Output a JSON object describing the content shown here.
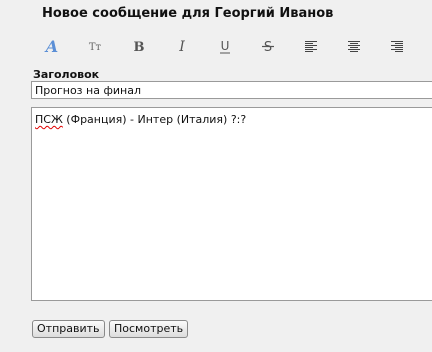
{
  "form": {
    "title": "Новое сообщение для Георгий Иванов",
    "subject_label": "Заголовок",
    "subject_value": "Прогноз на финал",
    "body": {
      "misspelled_word": "ПСЖ",
      "rest_of_line": " (Франция) - Интер (Италия) ?:?"
    },
    "send_label": "Отправить",
    "preview_label": "Посмотреть"
  },
  "toolbar": {
    "font_glyph": "A",
    "size_glyph": "Tт",
    "bold_glyph": "B",
    "italic_glyph": "I",
    "underline_glyph": "U",
    "strike_glyph": "S",
    "items": [
      {
        "icon": "font-icon"
      },
      {
        "icon": "font-size-icon"
      },
      {
        "icon": "bold-icon"
      },
      {
        "icon": "italic-icon"
      },
      {
        "icon": "underline-icon"
      },
      {
        "icon": "strikethrough-icon"
      },
      {
        "icon": "align-left-icon"
      },
      {
        "icon": "align-center-icon"
      },
      {
        "icon": "align-right-icon"
      }
    ]
  },
  "colors": {
    "background": "#f0f0f0",
    "font_icon": "#5b8fd6",
    "spellcheck_underline": "#e00000"
  }
}
